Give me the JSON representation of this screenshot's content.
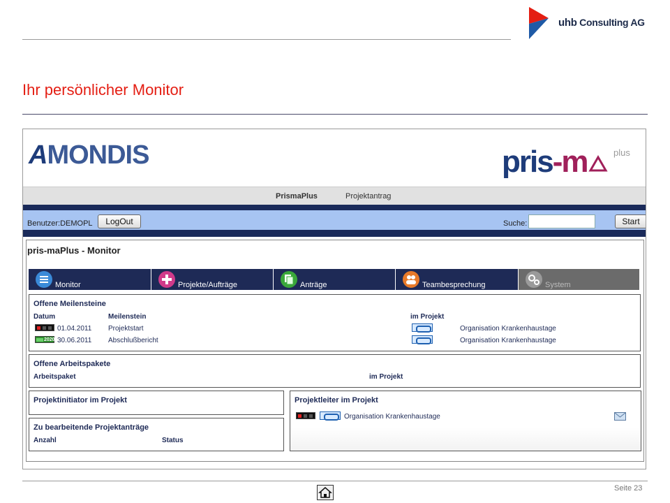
{
  "header": {
    "brand_logo": "uhb Consulting AG",
    "brand_logo_strong": "uhb",
    "brand_logo_rest": " Consulting AG",
    "brand_colors": {
      "red": "#e41e13",
      "blue": "#1f5aa6",
      "navy": "#1d2b4a"
    }
  },
  "slide": {
    "title": "Ihr persönlicher Monitor",
    "page_label": "Seite 23"
  },
  "app": {
    "company_logo": "AMONDIS",
    "company_logo_a": "A",
    "company_logo_rest": "MONDIS",
    "product_logo": "pris-ma",
    "product_logo_pris": "pris",
    "product_logo_dash": "-",
    "product_logo_m": "m",
    "product_logo_plus": "plus",
    "menu": [
      {
        "label": "PrismaPlus",
        "active": true
      },
      {
        "label": "Projektantrag",
        "active": false
      }
    ],
    "user_bar": {
      "user_label": "Benutzer:DEMOPL",
      "logout_label": "LogOut",
      "search_label": "Suche:",
      "search_value": "",
      "start_label": "Start"
    },
    "monitor": {
      "title": "pris-maPlus - Monitor",
      "tabs": [
        {
          "label": "Monitor",
          "icon": "list-icon",
          "color": "#3a8ad8"
        },
        {
          "label": "Projekte/Aufträge",
          "icon": "plus-icon",
          "color": "#d03a8a"
        },
        {
          "label": "Anträge",
          "icon": "documents-icon",
          "color": "#3aa83a"
        },
        {
          "label": "Teambesprechung",
          "icon": "people-icon",
          "color": "#e87a2a"
        },
        {
          "label": "System",
          "icon": "gears-icon",
          "color": "#9a9a9a"
        }
      ],
      "milestones": {
        "title": "Offene Meilensteine",
        "headers": {
          "date": "Datum",
          "milestone": "Meilenstein",
          "project": "im Projekt"
        },
        "rows": [
          {
            "status": "red",
            "date": "01.04.2011",
            "milestone": "Projektstart",
            "project": "Organisation Krankenhaustage"
          },
          {
            "status": "green-2020",
            "status_label": "2020",
            "date": "30.06.2011",
            "milestone": "Abschlußbericht",
            "project": "Organisation Krankenhaustage"
          }
        ]
      },
      "work_packages": {
        "title": "Offene Arbeitspakete",
        "headers": {
          "package": "Arbeitspaket",
          "project": "im Projekt"
        }
      },
      "initiator": {
        "title": "Projektinitiator im Projekt"
      },
      "proposals": {
        "title": "Zu bearbeitende Projektanträge",
        "headers": {
          "count": "Anzahl",
          "status": "Status"
        }
      },
      "project_lead": {
        "title": "Projektleiter im Projekt",
        "rows": [
          {
            "status": "red",
            "project": "Organisation Krankenhaustage"
          }
        ]
      }
    }
  }
}
